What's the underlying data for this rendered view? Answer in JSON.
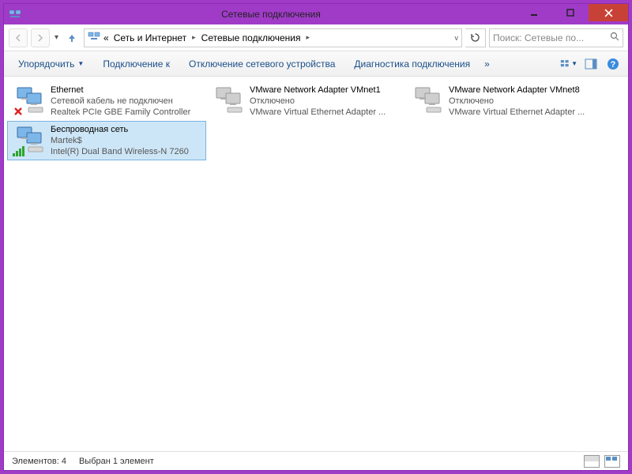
{
  "window": {
    "title": "Сетевые подключения"
  },
  "nav": {
    "crumb_prefix": "«",
    "crumb1": "Сеть и Интернет",
    "crumb2": "Сетевые подключения"
  },
  "search": {
    "placeholder": "Поиск: Сетевые по..."
  },
  "toolbar": {
    "organize": "Упорядочить",
    "connect": "Подключение к",
    "disable": "Отключение сетевого устройства",
    "diagnose": "Диагностика подключения",
    "more": "»"
  },
  "connections": [
    {
      "name": "Ethernet",
      "status": "Сетевой кабель не подключен",
      "device": "Realtek PCIe GBE Family Controller",
      "overlay": "x",
      "selected": false
    },
    {
      "name": "VMware Network Adapter VMnet1",
      "status": "Отключено",
      "device": "VMware Virtual Ethernet Adapter ...",
      "overlay": "gray",
      "selected": false
    },
    {
      "name": "VMware Network Adapter VMnet8",
      "status": "Отключено",
      "device": "VMware Virtual Ethernet Adapter ...",
      "overlay": "gray",
      "selected": false
    },
    {
      "name": "Беспроводная сеть",
      "status": "Martek$",
      "device": "Intel(R) Dual Band Wireless-N 7260",
      "overlay": "wifi",
      "selected": true
    }
  ],
  "statusbar": {
    "count_label": "Элементов: 4",
    "selected_label": "Выбран 1 элемент"
  }
}
